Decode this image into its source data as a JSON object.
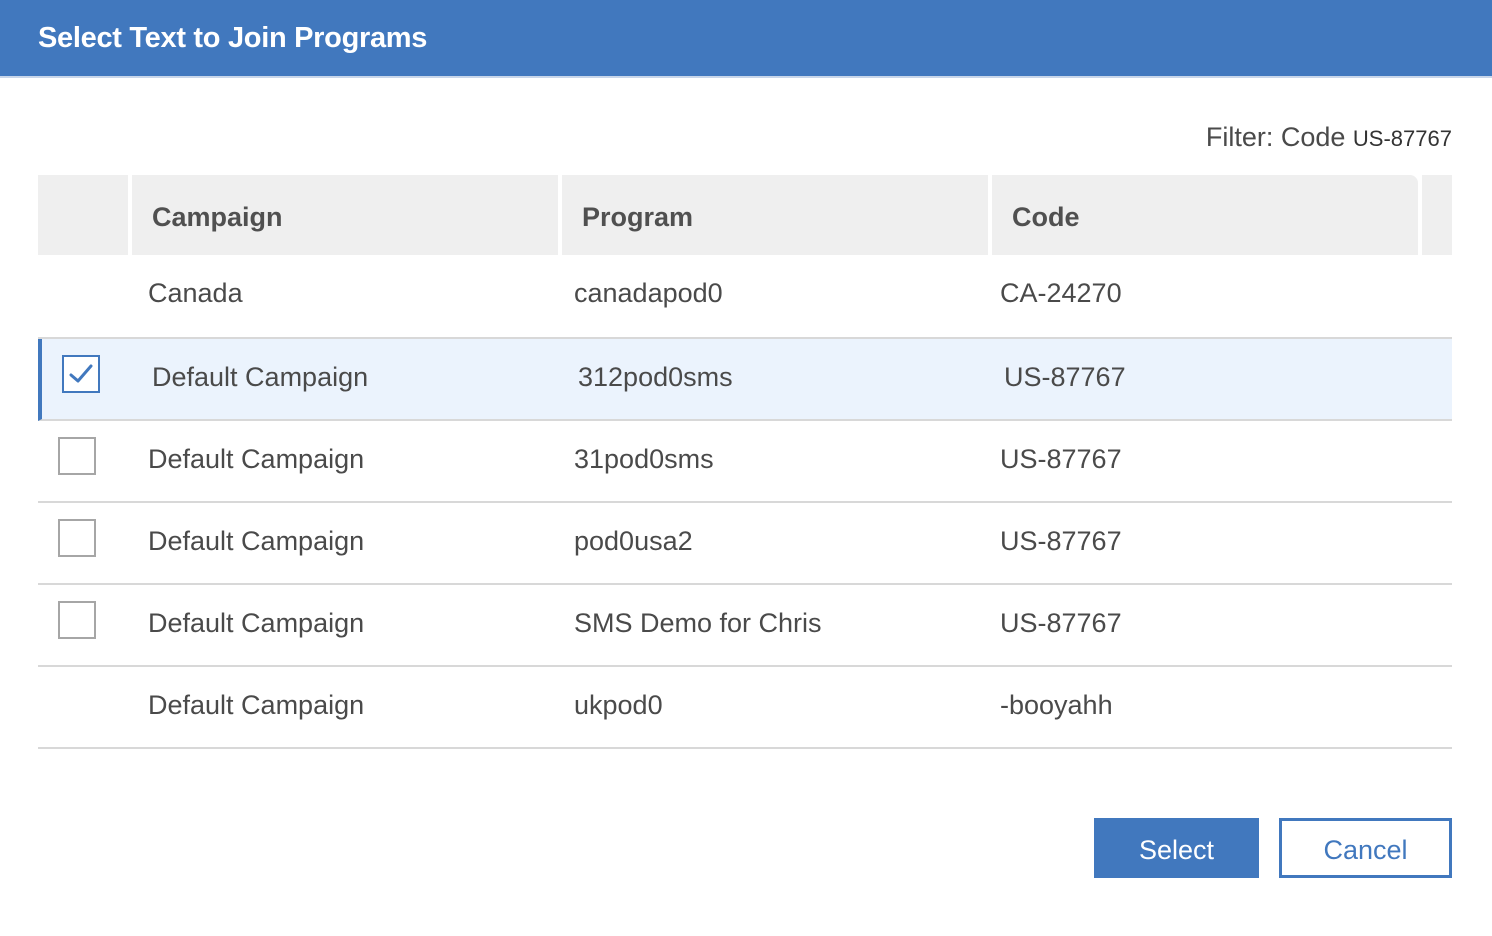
{
  "dialog": {
    "title": "Select Text to Join Programs"
  },
  "filter": {
    "label": "Filter: Code",
    "value": "US-87767"
  },
  "table": {
    "columns": [
      "",
      "Campaign",
      "Program",
      "Code"
    ],
    "rows": [
      {
        "campaign": "Canada",
        "program": "canadapod0",
        "code": "CA-24270",
        "has_checkbox": false,
        "checked": false
      },
      {
        "campaign": "Default Campaign",
        "program": "312pod0sms",
        "code": "US-87767",
        "has_checkbox": true,
        "checked": true
      },
      {
        "campaign": "Default Campaign",
        "program": "31pod0sms",
        "code": "US-87767",
        "has_checkbox": true,
        "checked": false
      },
      {
        "campaign": "Default Campaign",
        "program": "pod0usa2",
        "code": "US-87767",
        "has_checkbox": true,
        "checked": false
      },
      {
        "campaign": "Default Campaign",
        "program": "SMS Demo for Chris",
        "code": "US-87767",
        "has_checkbox": true,
        "checked": false
      },
      {
        "campaign": "Default Campaign",
        "program": "ukpod0",
        "code": "-booyahh",
        "has_checkbox": false,
        "checked": false
      }
    ]
  },
  "buttons": {
    "select_label": "Select",
    "cancel_label": "Cancel"
  },
  "colors": {
    "accent": "#4178be",
    "header_bg": "#efefef",
    "selected_row_bg": "#ebf3fd"
  },
  "icons": {
    "check": "checkmark-icon"
  }
}
